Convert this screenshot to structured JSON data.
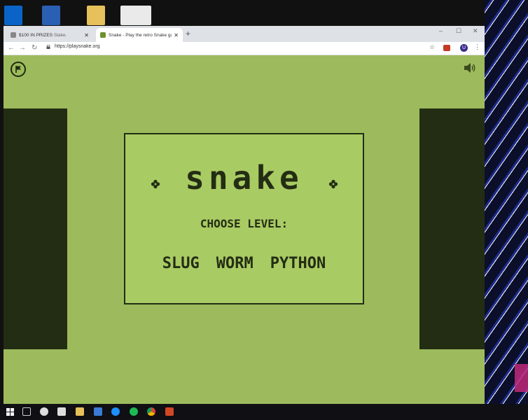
{
  "browser": {
    "tabs": [
      {
        "title": "$100 IN PRIZES",
        "extra": "Stake.",
        "active": false
      },
      {
        "title": "Snake - Play the retro Snake gam",
        "active": true
      }
    ],
    "new_tab_label": "+",
    "window_controls": {
      "minimize": "–",
      "maximize": "☐",
      "close": "✕"
    },
    "nav": {
      "back": "←",
      "forward": "→",
      "reload": "↻"
    },
    "url": "https://playsnake.org",
    "star": "☆",
    "profile_letter": "U",
    "menu": "⋮"
  },
  "game": {
    "logo": "snake",
    "prompt": "CHOOSE LEVEL:",
    "levels": [
      "SLUG",
      "WORM",
      "PYTHON"
    ],
    "colors": {
      "background": "#9dbb5c",
      "panel": "#232d14",
      "box": "#a9cb63"
    }
  },
  "icons": {
    "flag": "flag-icon",
    "sound": "speaker-icon"
  }
}
